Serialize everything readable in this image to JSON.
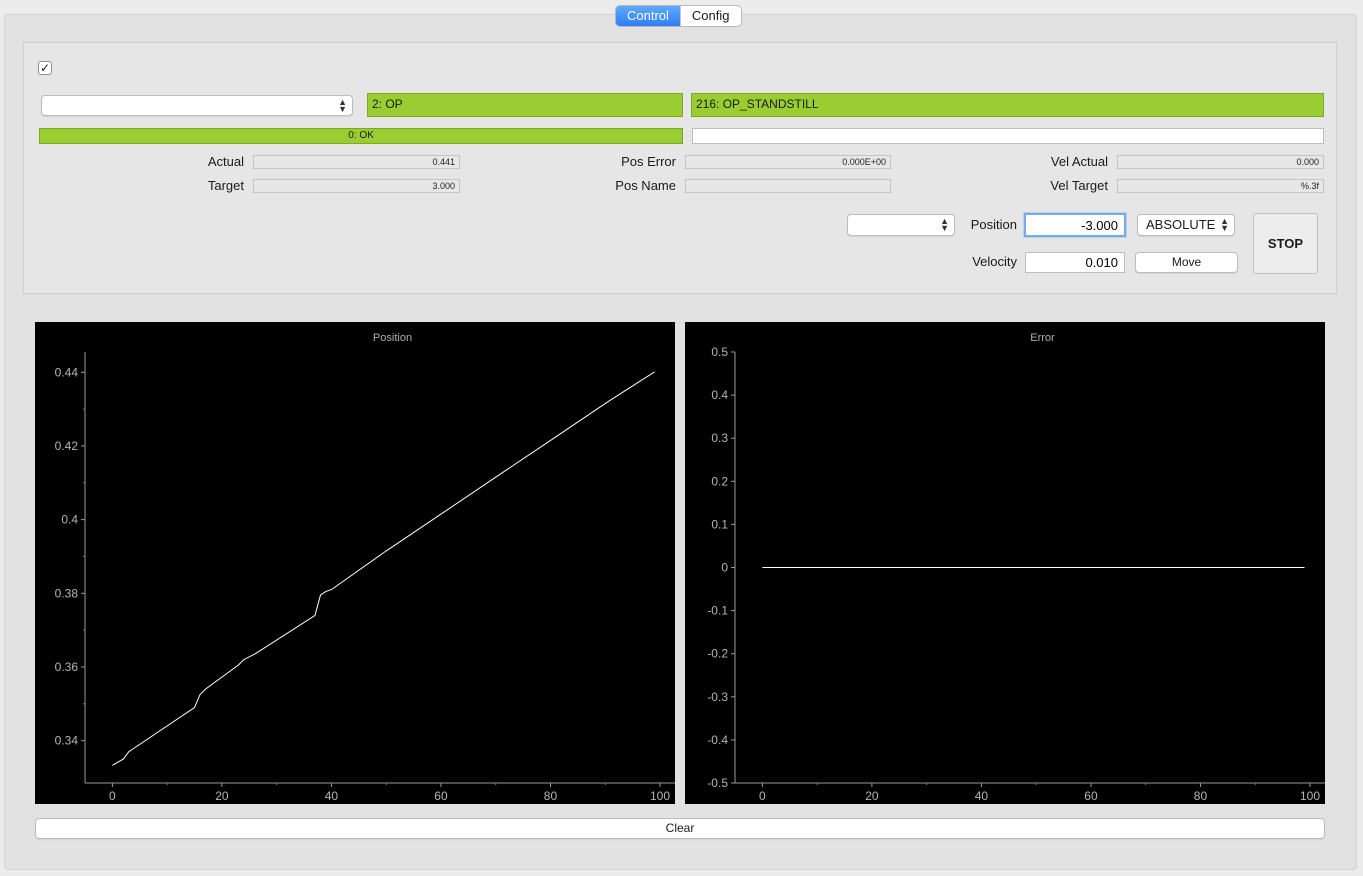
{
  "tabs": [
    {
      "label": "Control",
      "active": true
    },
    {
      "label": "Config",
      "active": false
    }
  ],
  "enable_checkbox": {
    "checked": true,
    "glyph": "✓"
  },
  "axis_combo": {
    "value": ""
  },
  "state": {
    "label": "2: OP",
    "color": "#9acd32"
  },
  "status": {
    "label": "216: OP_STANDSTILL",
    "color": "#9acd32"
  },
  "error_bar": {
    "label": "0: OK"
  },
  "message_bar": {
    "label": ""
  },
  "readouts": {
    "actual": {
      "label": "Actual",
      "value": "0.441"
    },
    "target": {
      "label": "Target",
      "value": "3.000"
    },
    "pos_error": {
      "label": "Pos Error",
      "value": "0.000E+00"
    },
    "pos_name": {
      "label": "Pos Name",
      "value": ""
    },
    "vel_actual": {
      "label": "Vel Actual",
      "value": "0.000"
    },
    "vel_target": {
      "label": "Vel Target",
      "value": "%.3f"
    }
  },
  "move": {
    "preset_combo": "",
    "position_label": "Position",
    "position_value": "-3.000",
    "mode": "ABSOLUTE",
    "velocity_label": "Velocity",
    "velocity_value": "0.010",
    "move_label": "Move",
    "stop_label": "STOP"
  },
  "clear_label": "Clear",
  "chart_data": [
    {
      "type": "line",
      "title": "Position",
      "xlim": [
        -5,
        100
      ],
      "ylim": [
        0.3285,
        0.4455
      ],
      "xticks": [
        0,
        20,
        40,
        60,
        80,
        100
      ],
      "yticks": [
        0.34,
        0.36,
        0.38,
        0.4,
        0.42,
        0.44
      ],
      "ytick_labels": [
        "0.34",
        "0.36",
        "0.38",
        "0.4",
        "0.42",
        "0.44"
      ],
      "series": [
        {
          "color": "#ffffff",
          "x": [
            0,
            2,
            3,
            4,
            15,
            16,
            17,
            23,
            24,
            26,
            37,
            38,
            39,
            40,
            50,
            60,
            70,
            80,
            90,
            91,
            99
          ],
          "y": [
            0.3333,
            0.335,
            0.337,
            0.338,
            0.349,
            0.3525,
            0.354,
            0.3605,
            0.362,
            0.3635,
            0.374,
            0.3795,
            0.3805,
            0.381,
            0.3915,
            0.4015,
            0.4115,
            0.4215,
            0.4315,
            0.4325,
            0.4401
          ]
        }
      ]
    },
    {
      "type": "line",
      "title": "Error",
      "xlim": [
        -5,
        100
      ],
      "ylim": [
        -0.5,
        0.5
      ],
      "xticks": [
        0,
        20,
        40,
        60,
        80,
        100
      ],
      "yticks": [
        -0.5,
        -0.4,
        -0.3,
        -0.2,
        -0.1,
        0,
        0.1,
        0.2,
        0.3,
        0.4,
        0.5
      ],
      "ytick_labels": [
        "-0.5",
        "-0.4",
        "-0.3",
        "-0.2",
        "-0.1",
        "0",
        "0.1",
        "0.2",
        "0.3",
        "0.4",
        "0.5"
      ],
      "series": [
        {
          "color": "#ffffff",
          "x": [
            0,
            99
          ],
          "y": [
            0,
            0
          ]
        }
      ]
    }
  ]
}
